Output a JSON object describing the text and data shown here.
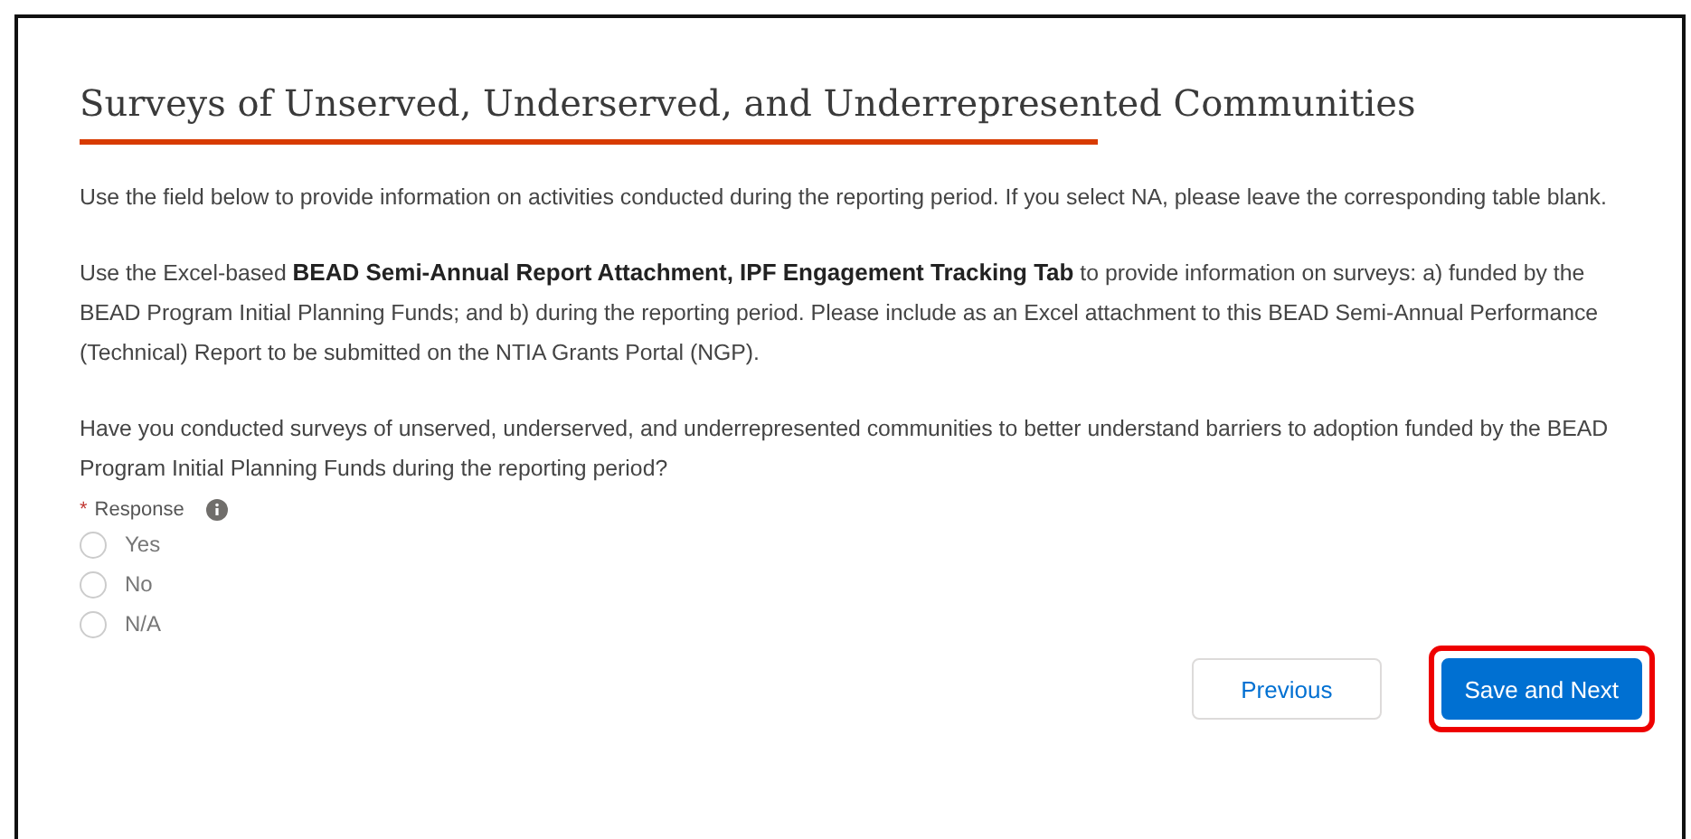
{
  "title": "Surveys of Unserved, Underserved, and Underrepresented Communities",
  "paragraphs": [
    "Use the field below to provide information on activities conducted during the reporting period. If you select NA, please leave the corresponding table blank.",
    "Use the Excel-based **BEAD Semi-Annual Report Attachment, IPF Engagement Tracking Tab** to provide information on surveys: a) funded by the BEAD Program Initial Planning Funds; and b) during the reporting period. Please include as an Excel attachment to this BEAD Semi-Annual Performance (Technical) Report to be submitted on the NTIA Grants Portal (NGP).",
    "Have you conducted surveys of unserved, underserved, and underrepresented communities to better understand barriers to adoption funded by the BEAD Program Initial Planning Funds during the reporting period?"
  ],
  "response": {
    "required_mark": "*",
    "label": "Response",
    "options": [
      {
        "label": "Yes",
        "selected": false
      },
      {
        "label": "No",
        "selected": false
      },
      {
        "label": "N/A",
        "selected": false
      }
    ]
  },
  "buttons": [
    {
      "label": "Previous",
      "kind": "neutral",
      "highlighted": false
    },
    {
      "label": "Save and Next",
      "kind": "brand",
      "highlighted": true
    }
  ]
}
